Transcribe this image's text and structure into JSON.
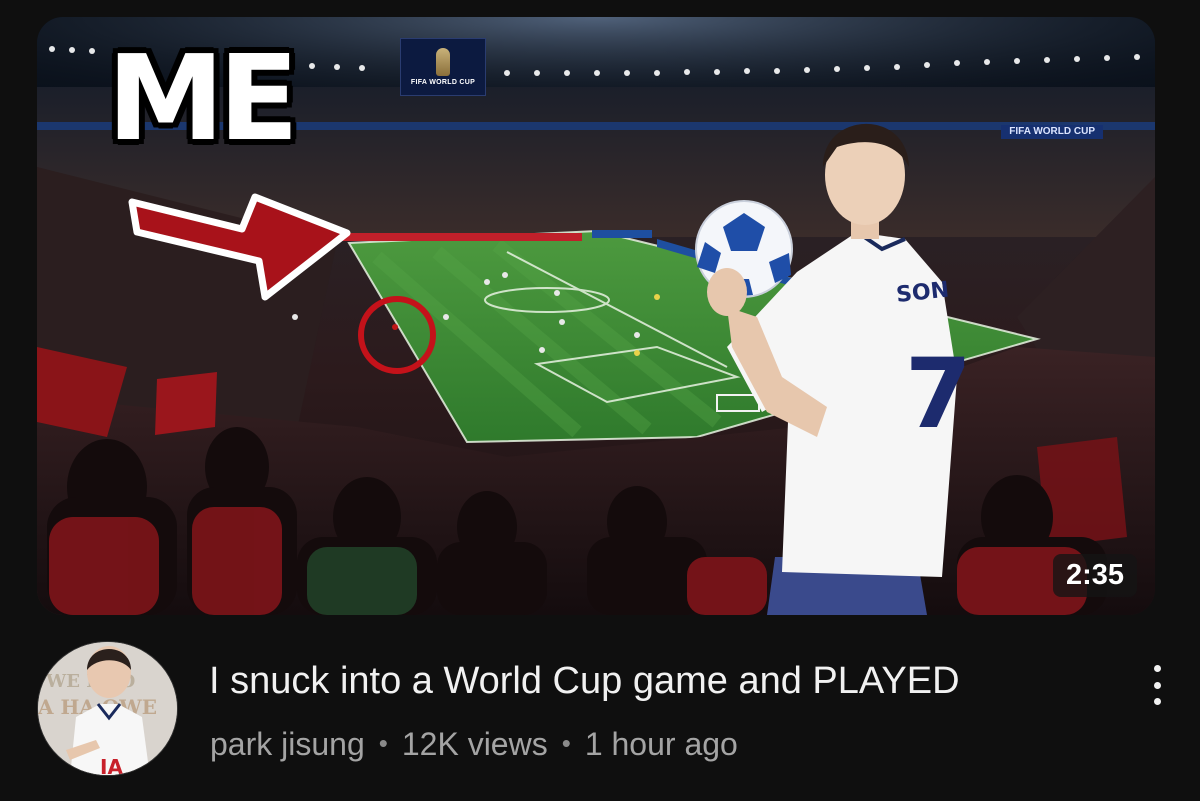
{
  "video": {
    "overlay_text": "ME",
    "duration": "2:35",
    "stadium_logo_text": "FIFA WORLD CUP",
    "stadium_banner_text": "FIFA WORLD CUP",
    "jersey_name": "SON",
    "jersey_number": "7",
    "title": "I snuck into a World Cup game and PLAYED",
    "channel": "park jisung",
    "views": "12K views",
    "age": "1 hour ago"
  },
  "channel_avatar": {
    "banner_text": "WELCOME TO A HALLOWEEN"
  },
  "icons": {
    "menu": "more-vert-icon",
    "arrow": "red-arrow-icon",
    "circle": "red-circle-marker"
  },
  "colors": {
    "background": "#0f0f0f",
    "title": "#f1f1f1",
    "meta": "#a4a4a4",
    "arrow": "#a8121a",
    "pitch": "#3f8a36"
  }
}
